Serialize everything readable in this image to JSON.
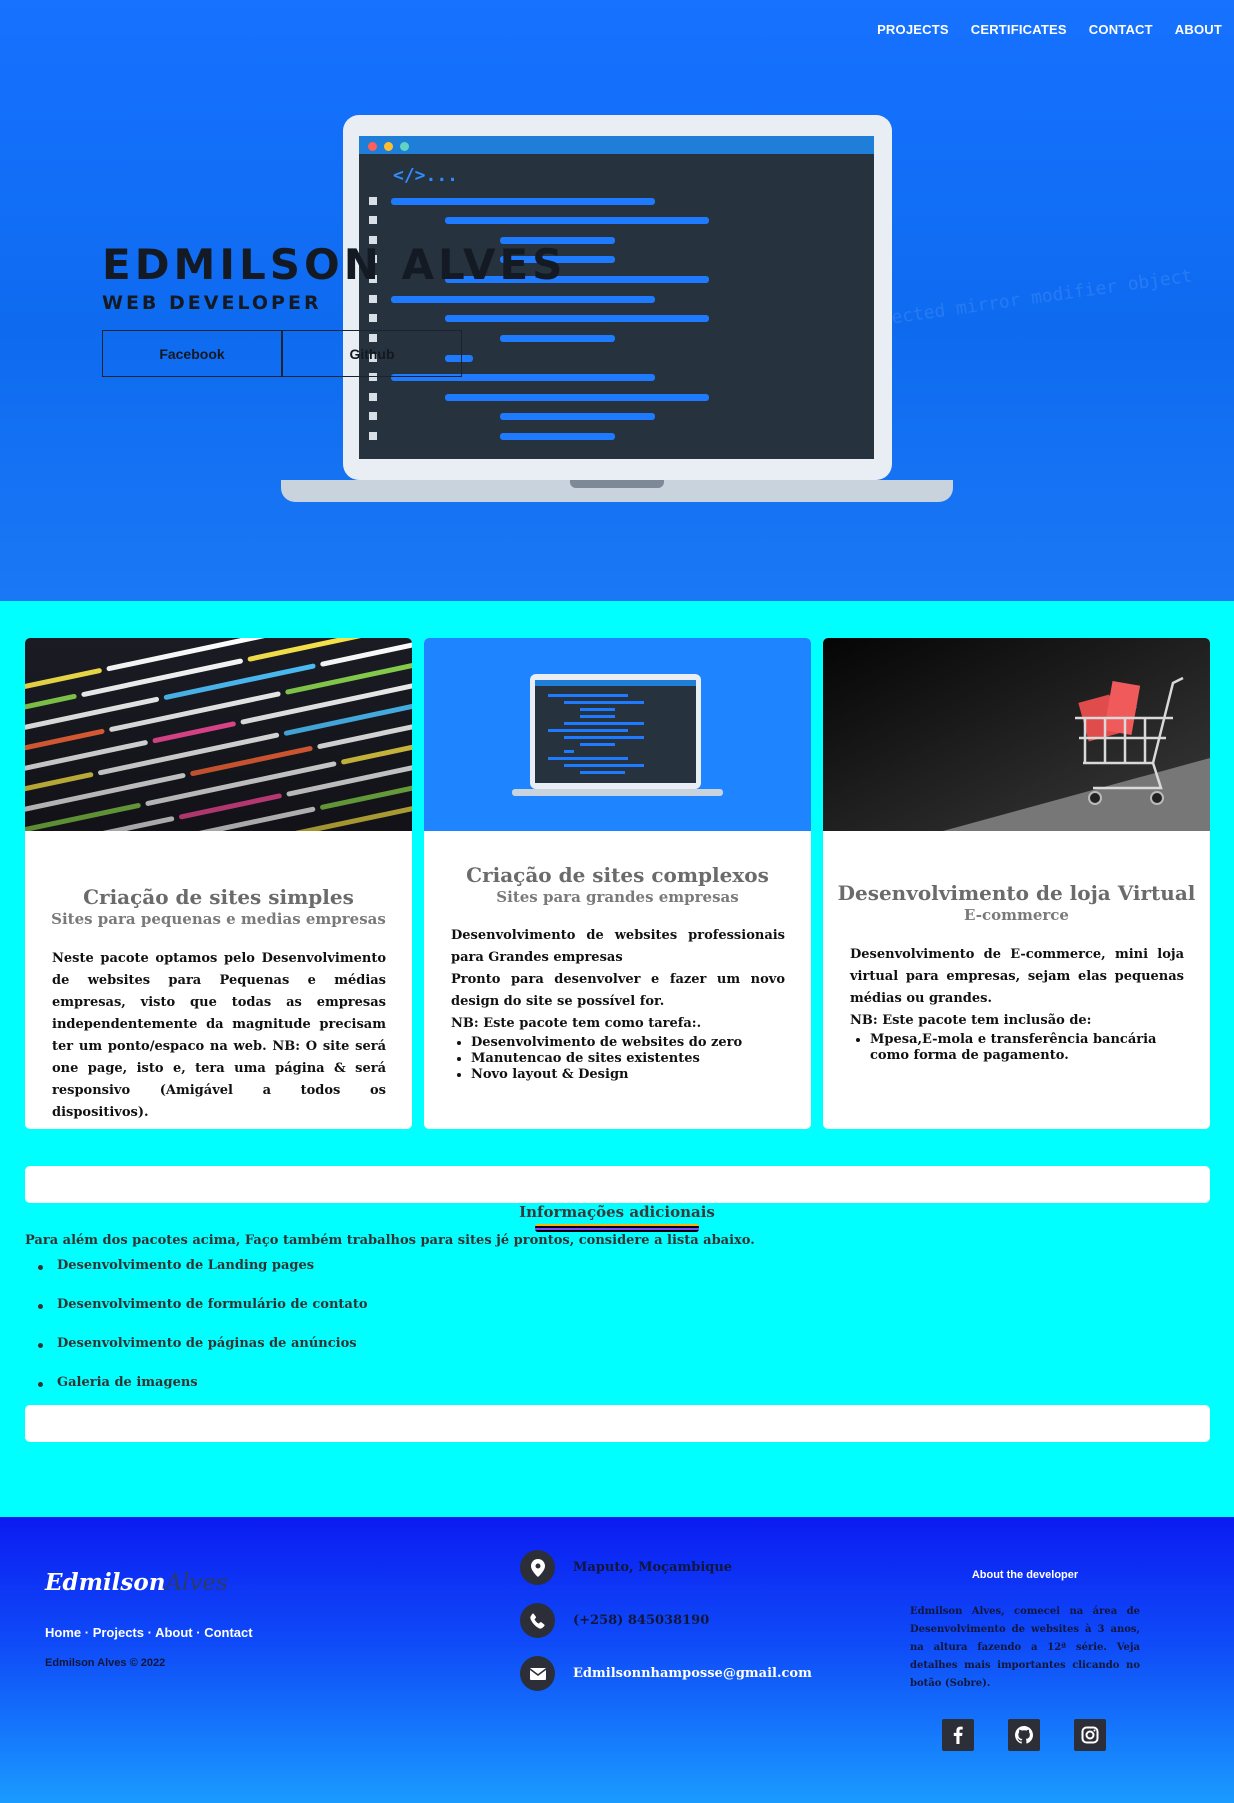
{
  "nav": {
    "items": [
      "PROJECTS",
      "CERTIFICATES",
      "CONTACT",
      "ABOUT"
    ]
  },
  "hero": {
    "name": "EDMILSON ALVES",
    "role": "WEB DEVELOPER",
    "buttons": [
      "Facebook",
      "Github"
    ],
    "code_tag": "</>...",
    "bg_code": "and back the deselected mirror modifier object"
  },
  "cards": [
    {
      "title": "Criação de sites simples",
      "subtitle": "Sites para pequenas e medias empresas",
      "body": "Neste pacote optamos pelo Desenvolvimento de websites para Pequenas e médias empresas, visto que todas as empresas independentemente da magnitude precisam ter um ponto/espaco na web. NB: O site será one page, isto e, tera uma página & será responsivo (Amigável a todos os dispositivos)."
    },
    {
      "title": "Criação de sites complexos",
      "subtitle": "Sites para grandes empresas",
      "body1": "Desenvolvimento de websites professionais para Grandes empresas",
      "body2": "Pronto para desenvolver e fazer um novo design do site se possível for.",
      "body3": "NB: Este pacote tem como tarefa:.",
      "list": [
        "Desenvolvimento de websites do zero",
        "Manutencao de sites existentes",
        "Novo layout & Design"
      ]
    },
    {
      "title": "Desenvolvimento de loja Virtual",
      "subtitle": "E-commerce",
      "body1": "Desenvolvimento de E-commerce, mini loja virtual para empresas, sejam elas pequenas médias ou grandes.",
      "body2": "NB: Este pacote tem inclusão de:",
      "list": [
        "Mpesa,E-mola e transferência bancária como forma de pagamento."
      ]
    }
  ],
  "info": {
    "title": "Informações adicionais",
    "text": "Para além dos pacotes acima, Faço também trabalhos para sites jé prontos, considere a lista abaixo.",
    "list": [
      "Desenvolvimento de Landing pages",
      "Desenvolvimento de formulário de contato",
      "Desenvolvimento de páginas de anúncios",
      "Galeria de imagens"
    ]
  },
  "footer": {
    "logo_first": "Edmilson",
    "logo_second": "Alves",
    "links": [
      "Home",
      "Projects",
      "About",
      "Contact"
    ],
    "copyright": "Edmilson Alves © 2022",
    "location": "Maputo, Moçambique",
    "phone": "(+258) 845038190",
    "email": "Edmilsonnhamposse@gmail.com",
    "about_title": "About the developer",
    "about_text": "Edmilson Alves, comecei na área de Desenvolvimento de websites à 3 anos, na altura fazendo a 12ª série. Veja detalhes mais importantes clicando no botão (Sobre).",
    "social": [
      "facebook-icon",
      "github-icon",
      "instagram-icon"
    ]
  },
  "colors": {
    "hero_bg": "#1672ff",
    "page_bg": "#00ffff",
    "footer_bg": "#0b1bf2",
    "accent": "#1e7bff"
  }
}
